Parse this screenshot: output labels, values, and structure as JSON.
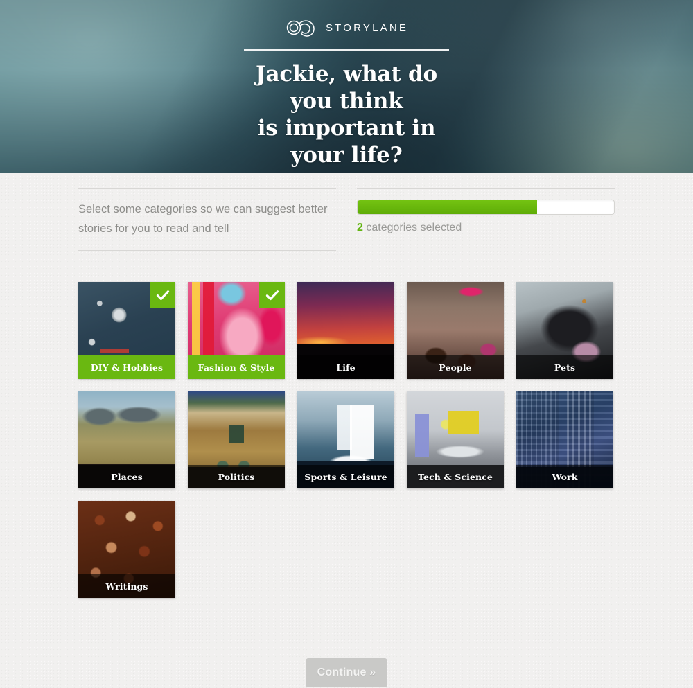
{
  "brand": {
    "name": "STORYLANE",
    "logo_icon": "infinity-icon"
  },
  "hero": {
    "headline": "Jackie, what do you think\nis important in your life?",
    "dots": [
      {
        "active": true
      },
      {
        "active": false
      },
      {
        "active": false
      }
    ]
  },
  "info": {
    "instructions": "Select some categories so we can suggest better\nstories for you to read and tell",
    "progress": {
      "percent": 70,
      "count": "2",
      "label": " categories selected",
      "fill_color": "#66bb14",
      "track_color": "#ffffff"
    }
  },
  "categories": [
    {
      "label": "DIY & Hobbies",
      "selected": true,
      "photo": "ph-diy",
      "check_icon": "check-icon"
    },
    {
      "label": "Fashion & Style",
      "selected": true,
      "photo": "ph-fashion",
      "check_icon": "check-icon"
    },
    {
      "label": "Life",
      "selected": false,
      "photo": "ph-life",
      "check_icon": "check-icon"
    },
    {
      "label": "People",
      "selected": false,
      "photo": "ph-people",
      "check_icon": "check-icon"
    },
    {
      "label": "Pets",
      "selected": false,
      "photo": "ph-pets",
      "check_icon": "check-icon"
    },
    {
      "label": "Places",
      "selected": false,
      "photo": "ph-places",
      "check_icon": "check-icon"
    },
    {
      "label": "Politics",
      "selected": false,
      "photo": "ph-politics",
      "check_icon": "check-icon"
    },
    {
      "label": "Sports & Leisure",
      "selected": false,
      "photo": "ph-sports",
      "check_icon": "check-icon"
    },
    {
      "label": "Tech & Science",
      "selected": false,
      "photo": "ph-tech",
      "check_icon": "check-icon"
    },
    {
      "label": "Work",
      "selected": false,
      "photo": "ph-work",
      "check_icon": "check-icon"
    },
    {
      "label": "Writings",
      "selected": false,
      "photo": "ph-writings",
      "check_icon": "check-icon"
    }
  ],
  "footer": {
    "continue_label": "Continue »"
  },
  "colors": {
    "accent_green": "#66bb14",
    "page_bg": "#f0efee",
    "muted_text": "#8d8d8a",
    "button_disabled": "#c9c9c7"
  }
}
